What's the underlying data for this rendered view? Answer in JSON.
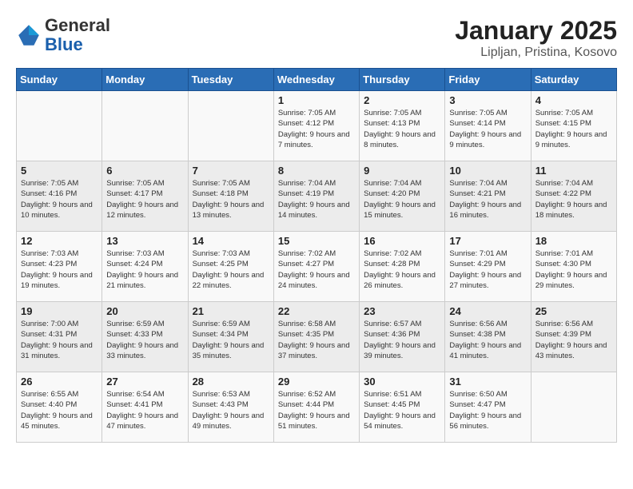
{
  "header": {
    "logo_general": "General",
    "logo_blue": "Blue",
    "month": "January 2025",
    "location": "Lipljan, Pristina, Kosovo"
  },
  "weekdays": [
    "Sunday",
    "Monday",
    "Tuesday",
    "Wednesday",
    "Thursday",
    "Friday",
    "Saturday"
  ],
  "weeks": [
    [
      {
        "day": "",
        "info": ""
      },
      {
        "day": "",
        "info": ""
      },
      {
        "day": "",
        "info": ""
      },
      {
        "day": "1",
        "info": "Sunrise: 7:05 AM\nSunset: 4:12 PM\nDaylight: 9 hours and 7 minutes."
      },
      {
        "day": "2",
        "info": "Sunrise: 7:05 AM\nSunset: 4:13 PM\nDaylight: 9 hours and 8 minutes."
      },
      {
        "day": "3",
        "info": "Sunrise: 7:05 AM\nSunset: 4:14 PM\nDaylight: 9 hours and 9 minutes."
      },
      {
        "day": "4",
        "info": "Sunrise: 7:05 AM\nSunset: 4:15 PM\nDaylight: 9 hours and 9 minutes."
      }
    ],
    [
      {
        "day": "5",
        "info": "Sunrise: 7:05 AM\nSunset: 4:16 PM\nDaylight: 9 hours and 10 minutes."
      },
      {
        "day": "6",
        "info": "Sunrise: 7:05 AM\nSunset: 4:17 PM\nDaylight: 9 hours and 12 minutes."
      },
      {
        "day": "7",
        "info": "Sunrise: 7:05 AM\nSunset: 4:18 PM\nDaylight: 9 hours and 13 minutes."
      },
      {
        "day": "8",
        "info": "Sunrise: 7:04 AM\nSunset: 4:19 PM\nDaylight: 9 hours and 14 minutes."
      },
      {
        "day": "9",
        "info": "Sunrise: 7:04 AM\nSunset: 4:20 PM\nDaylight: 9 hours and 15 minutes."
      },
      {
        "day": "10",
        "info": "Sunrise: 7:04 AM\nSunset: 4:21 PM\nDaylight: 9 hours and 16 minutes."
      },
      {
        "day": "11",
        "info": "Sunrise: 7:04 AM\nSunset: 4:22 PM\nDaylight: 9 hours and 18 minutes."
      }
    ],
    [
      {
        "day": "12",
        "info": "Sunrise: 7:03 AM\nSunset: 4:23 PM\nDaylight: 9 hours and 19 minutes."
      },
      {
        "day": "13",
        "info": "Sunrise: 7:03 AM\nSunset: 4:24 PM\nDaylight: 9 hours and 21 minutes."
      },
      {
        "day": "14",
        "info": "Sunrise: 7:03 AM\nSunset: 4:25 PM\nDaylight: 9 hours and 22 minutes."
      },
      {
        "day": "15",
        "info": "Sunrise: 7:02 AM\nSunset: 4:27 PM\nDaylight: 9 hours and 24 minutes."
      },
      {
        "day": "16",
        "info": "Sunrise: 7:02 AM\nSunset: 4:28 PM\nDaylight: 9 hours and 26 minutes."
      },
      {
        "day": "17",
        "info": "Sunrise: 7:01 AM\nSunset: 4:29 PM\nDaylight: 9 hours and 27 minutes."
      },
      {
        "day": "18",
        "info": "Sunrise: 7:01 AM\nSunset: 4:30 PM\nDaylight: 9 hours and 29 minutes."
      }
    ],
    [
      {
        "day": "19",
        "info": "Sunrise: 7:00 AM\nSunset: 4:31 PM\nDaylight: 9 hours and 31 minutes."
      },
      {
        "day": "20",
        "info": "Sunrise: 6:59 AM\nSunset: 4:33 PM\nDaylight: 9 hours and 33 minutes."
      },
      {
        "day": "21",
        "info": "Sunrise: 6:59 AM\nSunset: 4:34 PM\nDaylight: 9 hours and 35 minutes."
      },
      {
        "day": "22",
        "info": "Sunrise: 6:58 AM\nSunset: 4:35 PM\nDaylight: 9 hours and 37 minutes."
      },
      {
        "day": "23",
        "info": "Sunrise: 6:57 AM\nSunset: 4:36 PM\nDaylight: 9 hours and 39 minutes."
      },
      {
        "day": "24",
        "info": "Sunrise: 6:56 AM\nSunset: 4:38 PM\nDaylight: 9 hours and 41 minutes."
      },
      {
        "day": "25",
        "info": "Sunrise: 6:56 AM\nSunset: 4:39 PM\nDaylight: 9 hours and 43 minutes."
      }
    ],
    [
      {
        "day": "26",
        "info": "Sunrise: 6:55 AM\nSunset: 4:40 PM\nDaylight: 9 hours and 45 minutes."
      },
      {
        "day": "27",
        "info": "Sunrise: 6:54 AM\nSunset: 4:41 PM\nDaylight: 9 hours and 47 minutes."
      },
      {
        "day": "28",
        "info": "Sunrise: 6:53 AM\nSunset: 4:43 PM\nDaylight: 9 hours and 49 minutes."
      },
      {
        "day": "29",
        "info": "Sunrise: 6:52 AM\nSunset: 4:44 PM\nDaylight: 9 hours and 51 minutes."
      },
      {
        "day": "30",
        "info": "Sunrise: 6:51 AM\nSunset: 4:45 PM\nDaylight: 9 hours and 54 minutes."
      },
      {
        "day": "31",
        "info": "Sunrise: 6:50 AM\nSunset: 4:47 PM\nDaylight: 9 hours and 56 minutes."
      },
      {
        "day": "",
        "info": ""
      }
    ]
  ]
}
